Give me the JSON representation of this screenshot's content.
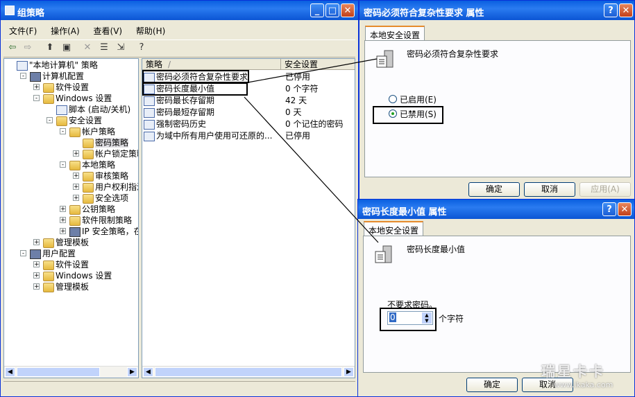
{
  "main": {
    "title": "组策略",
    "menu": [
      "文件(F)",
      "操作(A)",
      "查看(V)",
      "帮助(H)"
    ],
    "toolbar_icons": [
      "back-icon",
      "forward-icon",
      "up-folder-icon",
      "show-tree-icon",
      "delete-icon",
      "properties-icon",
      "export-icon",
      "help-icon"
    ],
    "tree": [
      {
        "label": "\"本地计算机\" 策略",
        "icon": "policy"
      },
      {
        "label": "计算机配置",
        "icon": "computer"
      },
      {
        "label": "软件设置",
        "icon": "folder"
      },
      {
        "label": "Windows 设置",
        "icon": "folder"
      },
      {
        "label": "脚本 (启动/关机)",
        "icon": "script"
      },
      {
        "label": "安全设置",
        "icon": "security"
      },
      {
        "label": "帐户策略",
        "icon": "folder"
      },
      {
        "label": "密码策略",
        "icon": "folder"
      },
      {
        "label": "帐户锁定策略",
        "icon": "folder"
      },
      {
        "label": "本地策略",
        "icon": "folder"
      },
      {
        "label": "审核策略",
        "icon": "folder"
      },
      {
        "label": "用户权利指派",
        "icon": "folder"
      },
      {
        "label": "安全选项",
        "icon": "folder"
      },
      {
        "label": "公钥策略",
        "icon": "folder"
      },
      {
        "label": "软件限制策略",
        "icon": "folder"
      },
      {
        "label": "IP 安全策略，在",
        "icon": "ipsec"
      },
      {
        "label": "管理模板",
        "icon": "folder"
      },
      {
        "label": "用户配置",
        "icon": "user"
      },
      {
        "label": "软件设置",
        "icon": "folder"
      },
      {
        "label": "Windows 设置",
        "icon": "folder"
      },
      {
        "label": "管理模板",
        "icon": "folder"
      }
    ],
    "list_headers": [
      "策略",
      "安全设置"
    ],
    "list_rows": [
      {
        "policy": "密码必须符合复杂性要求",
        "setting": "已停用"
      },
      {
        "policy": "密码长度最小值",
        "setting": "0 个字符"
      },
      {
        "policy": "密码最长存留期",
        "setting": "42 天"
      },
      {
        "policy": "密码最短存留期",
        "setting": "0 天"
      },
      {
        "policy": "强制密码历史",
        "setting": "0 个记住的密码"
      },
      {
        "policy": "为域中所有用户使用可还原的...",
        "setting": "已停用"
      }
    ]
  },
  "dialog1": {
    "title": "密码必须符合复杂性要求 属性",
    "tab": "本地安全设置",
    "policy_name": "密码必须符合复杂性要求",
    "option_enabled": "已启用(E)",
    "option_disabled": "已禁用(S)",
    "selected": "disabled",
    "ok": "确定",
    "cancel": "取消",
    "apply": "应用(A)"
  },
  "dialog2": {
    "title": "密码长度最小值 属性",
    "tab": "本地安全设置",
    "policy_name": "密码长度最小值",
    "note": "不要求密码。",
    "value": "0",
    "unit": "个字符",
    "ok": "确定",
    "cancel": "取消"
  },
  "watermark": {
    "brand": "瑞星卡卡",
    "url": "www.ikaka.com"
  },
  "colors": {
    "titlebar": "#0a5fe0",
    "desktop": "#3a6ea5",
    "window_bg": "#ece9d8",
    "highlight_box": "#000000"
  }
}
